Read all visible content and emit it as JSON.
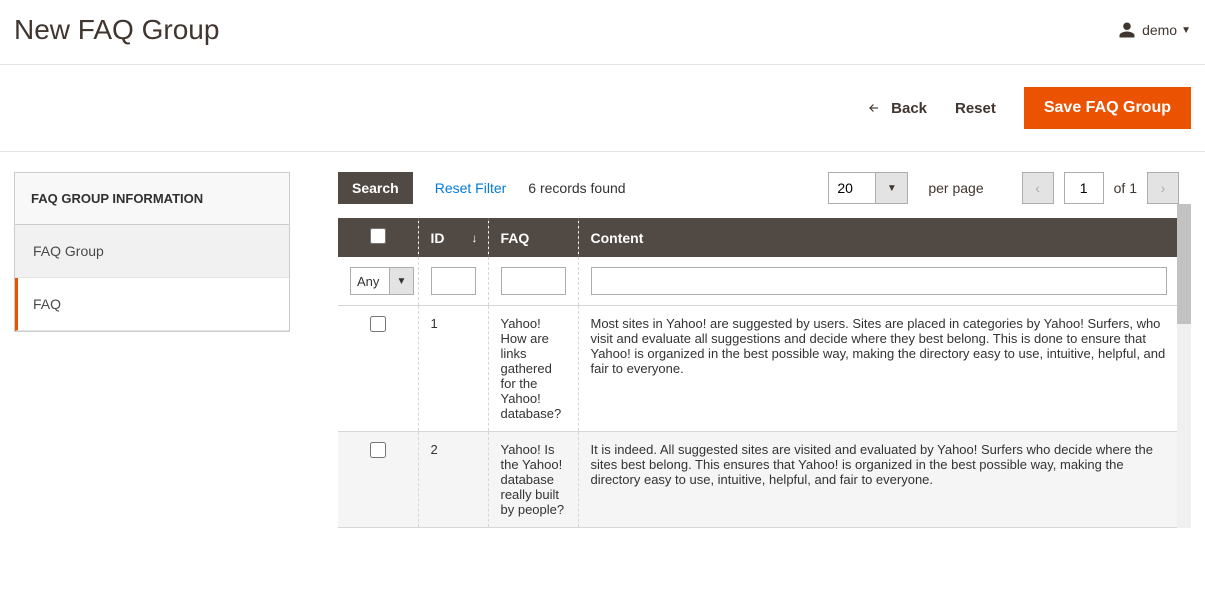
{
  "header": {
    "title": "New FAQ Group",
    "user_label": "demo"
  },
  "actions": {
    "back": "Back",
    "reset": "Reset",
    "save": "Save FAQ Group"
  },
  "sidebar": {
    "header": "FAQ GROUP INFORMATION",
    "items": [
      {
        "label": "FAQ Group"
      },
      {
        "label": "FAQ"
      }
    ]
  },
  "toolbar": {
    "search": "Search",
    "reset_filter": "Reset Filter",
    "records_found": "6 records found",
    "page_size": "20",
    "per_page": "per page",
    "current_page": "1",
    "of_text": "of 1"
  },
  "grid": {
    "columns": {
      "id": "ID",
      "faq": "FAQ",
      "content": "Content"
    },
    "filter_any": "Any",
    "rows": [
      {
        "id": "1",
        "faq": "Yahoo! How are links gathered for the Yahoo! database?",
        "content": "Most sites in Yahoo! are suggested by users. Sites are placed in categories by Yahoo! Surfers, who visit and evaluate all suggestions and decide where they best belong. This is done to ensure that Yahoo! is organized in the best possible way, making the directory easy to use, intuitive, helpful, and fair to everyone."
      },
      {
        "id": "2",
        "faq": "Yahoo! Is the Yahoo! database really built by people?",
        "content": "It is indeed. All suggested sites are visited and evaluated by Yahoo! Surfers who decide where the sites best belong. This ensures that Yahoo! is organized in the best possible way, making the directory easy to use, intuitive, helpful, and fair to everyone."
      }
    ]
  }
}
